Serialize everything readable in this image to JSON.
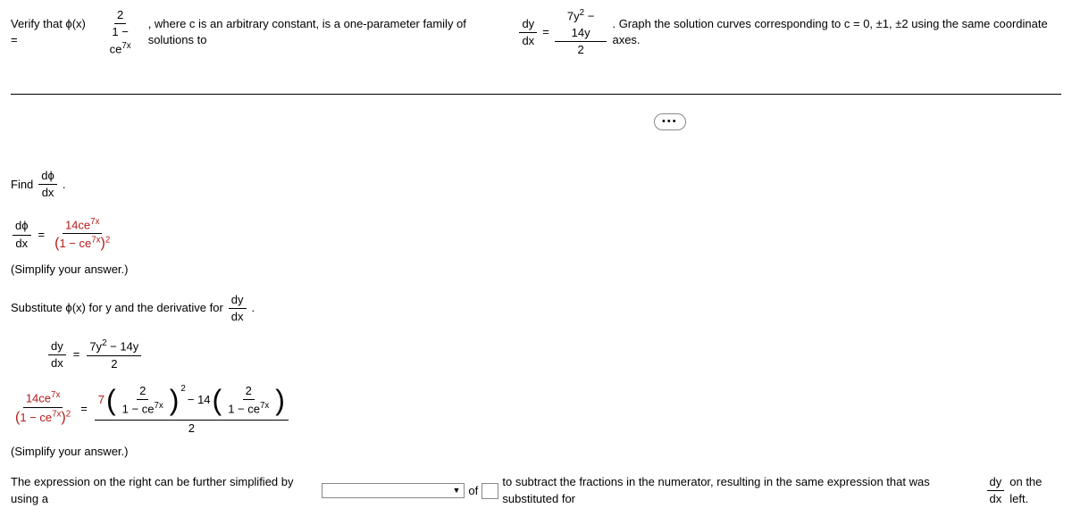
{
  "problem": {
    "verify": "Verify that ϕ(x) =",
    "frac1_num": "2",
    "frac1_den_pre": "1 − ce",
    "frac1_den_exp": "7x",
    "mid1": ", where c is an arbitrary constant, is a one-parameter family of solutions to",
    "dydx_num": "dy",
    "dydx_den": "dx",
    "eq": "=",
    "rhs_num_pre": "7y",
    "rhs_num_exp": "2",
    "rhs_num_post": " − 14y",
    "rhs_den": "2",
    "tail": ". Graph the solution curves corresponding to c = 0, ±1, ±2 using the same coordinate axes."
  },
  "step1": {
    "label": "Find",
    "num": "dϕ",
    "den": "dx",
    "period": "."
  },
  "derivative": {
    "lhs_num": "dϕ",
    "lhs_den": "dx",
    "eq": "=",
    "rhs_num_pre": "14ce",
    "rhs_num_exp": "7x",
    "rhs_den_open": "(",
    "rhs_den_pre": "1 − ce",
    "rhs_den_exp": "7x",
    "rhs_den_close": ")",
    "rhs_den_outer_exp": "2",
    "simplify": "(Simplify your answer.)"
  },
  "substitute": {
    "text1": "Substitute ϕ(x) for y and the derivative for",
    "num": "dy",
    "den": "dx",
    "period": "."
  },
  "eq_start": {
    "lhs_num": "dy",
    "lhs_den": "dx",
    "eq": "=",
    "rhs_num_pre": "7y",
    "rhs_num_exp": "2",
    "rhs_num_post": " − 14y",
    "rhs_den": "2"
  },
  "big_eq": {
    "lhs_num_pre": "14ce",
    "lhs_num_exp": "7x",
    "lhs_den_open": "(",
    "lhs_den_pre": "1 − ce",
    "lhs_den_exp": "7x",
    "lhs_den_close": ")",
    "lhs_den_outer_exp": "2",
    "eq": "=",
    "t1_coef": "7",
    "t1_num": "2",
    "t1_den_pre": "1 − ce",
    "t1_den_exp": "7x",
    "t1_outer_exp": "2",
    "minus": " − 14",
    "t2_num": "2",
    "t2_den_pre": "1 − ce",
    "t2_den_exp": "7x",
    "bottom_den": "2",
    "simplify": "(Simplify your answer.)"
  },
  "final": {
    "text1": "The expression on the right can be further simplified by using a",
    "of": "of",
    "text2": "to subtract the fractions in the numerator, resulting in the same expression that was substituted for",
    "num": "dy",
    "den": "dx",
    "tail": "on the left."
  }
}
